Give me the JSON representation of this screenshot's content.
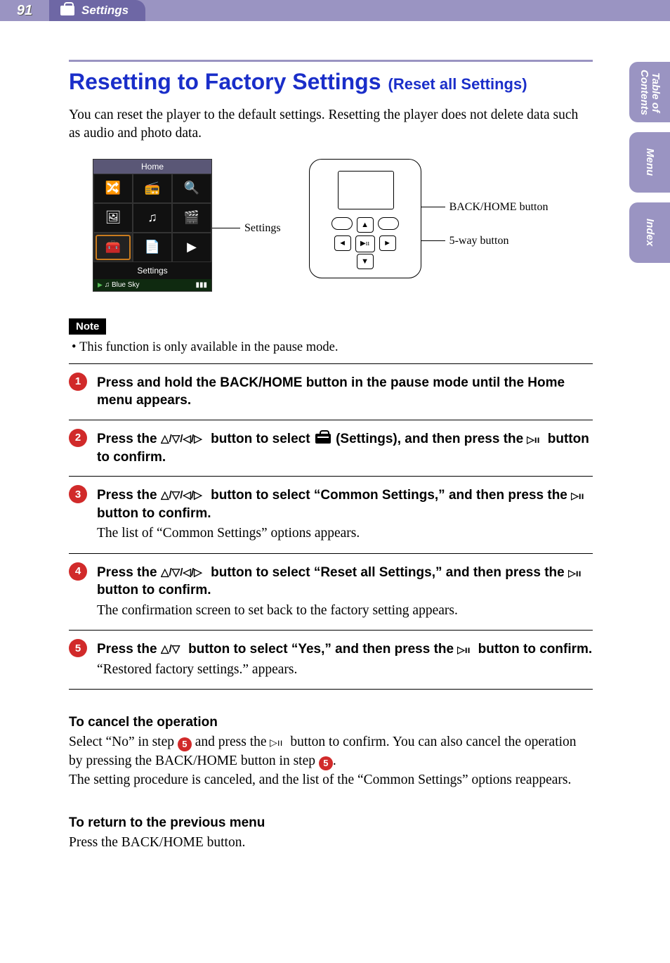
{
  "header": {
    "page_number": "91",
    "section": "Settings"
  },
  "sidetabs": [
    {
      "id": "toc",
      "label": "Table of\nContents"
    },
    {
      "id": "menu",
      "label": "Menu"
    },
    {
      "id": "index",
      "label": "Index"
    }
  ],
  "title_main": "Resetting to Factory Settings",
  "title_sub": "(Reset all Settings)",
  "lead": "You can reset the player to the default settings. Resetting the player does not delete data such as audio and photo data.",
  "illustration": {
    "screen_title": "Home",
    "screen_caption": "Settings",
    "screen_status_track": "♫ Blue Sky",
    "callout_settings": "Settings",
    "callout_backhome": "BACK/HOME button",
    "callout_5way": "5-way button"
  },
  "note": {
    "tag": "Note",
    "bullet": "This function is only available in the pause mode."
  },
  "steps": [
    {
      "n": "1",
      "bold": "Press and hold the BACK/HOME button in the pause mode until the Home menu appears.",
      "body": ""
    },
    {
      "n": "2",
      "bold_pre": "Press the ",
      "bold_mid": " button to select ",
      "bold_post": " (Settings), and then press the ",
      "bold_end": " button to confirm.",
      "body": ""
    },
    {
      "n": "3",
      "bold_pre": "Press the ",
      "bold_mid": " button to select “Common Settings,” and then press the ",
      "bold_end": " button to confirm.",
      "body": "The list of “Common Settings” options appears."
    },
    {
      "n": "4",
      "bold_pre": "Press the ",
      "bold_mid": " button to select “Reset all Settings,” and then press the ",
      "bold_end": " button to confirm.",
      "body": "The confirmation screen to set back to the factory setting appears."
    },
    {
      "n": "5",
      "bold_pre": "Press the ",
      "bold_mid": " button to select “Yes,” and then press the ",
      "bold_end": " button to confirm.",
      "body": "“Restored factory settings.” appears."
    }
  ],
  "cancel": {
    "head": "To cancel the operation",
    "p1a": "Select “No” in step ",
    "p1b": " and press the ",
    "p1c": " button to confirm. You can also cancel the operation by pressing the BACK/HOME button in step ",
    "p1d": ".",
    "p2": "The setting procedure is canceled, and the list of the “Common Settings” options reappears."
  },
  "return": {
    "head": "To return to the previous menu",
    "body": "Press the BACK/HOME button."
  },
  "inline_circles": {
    "five": "5"
  }
}
